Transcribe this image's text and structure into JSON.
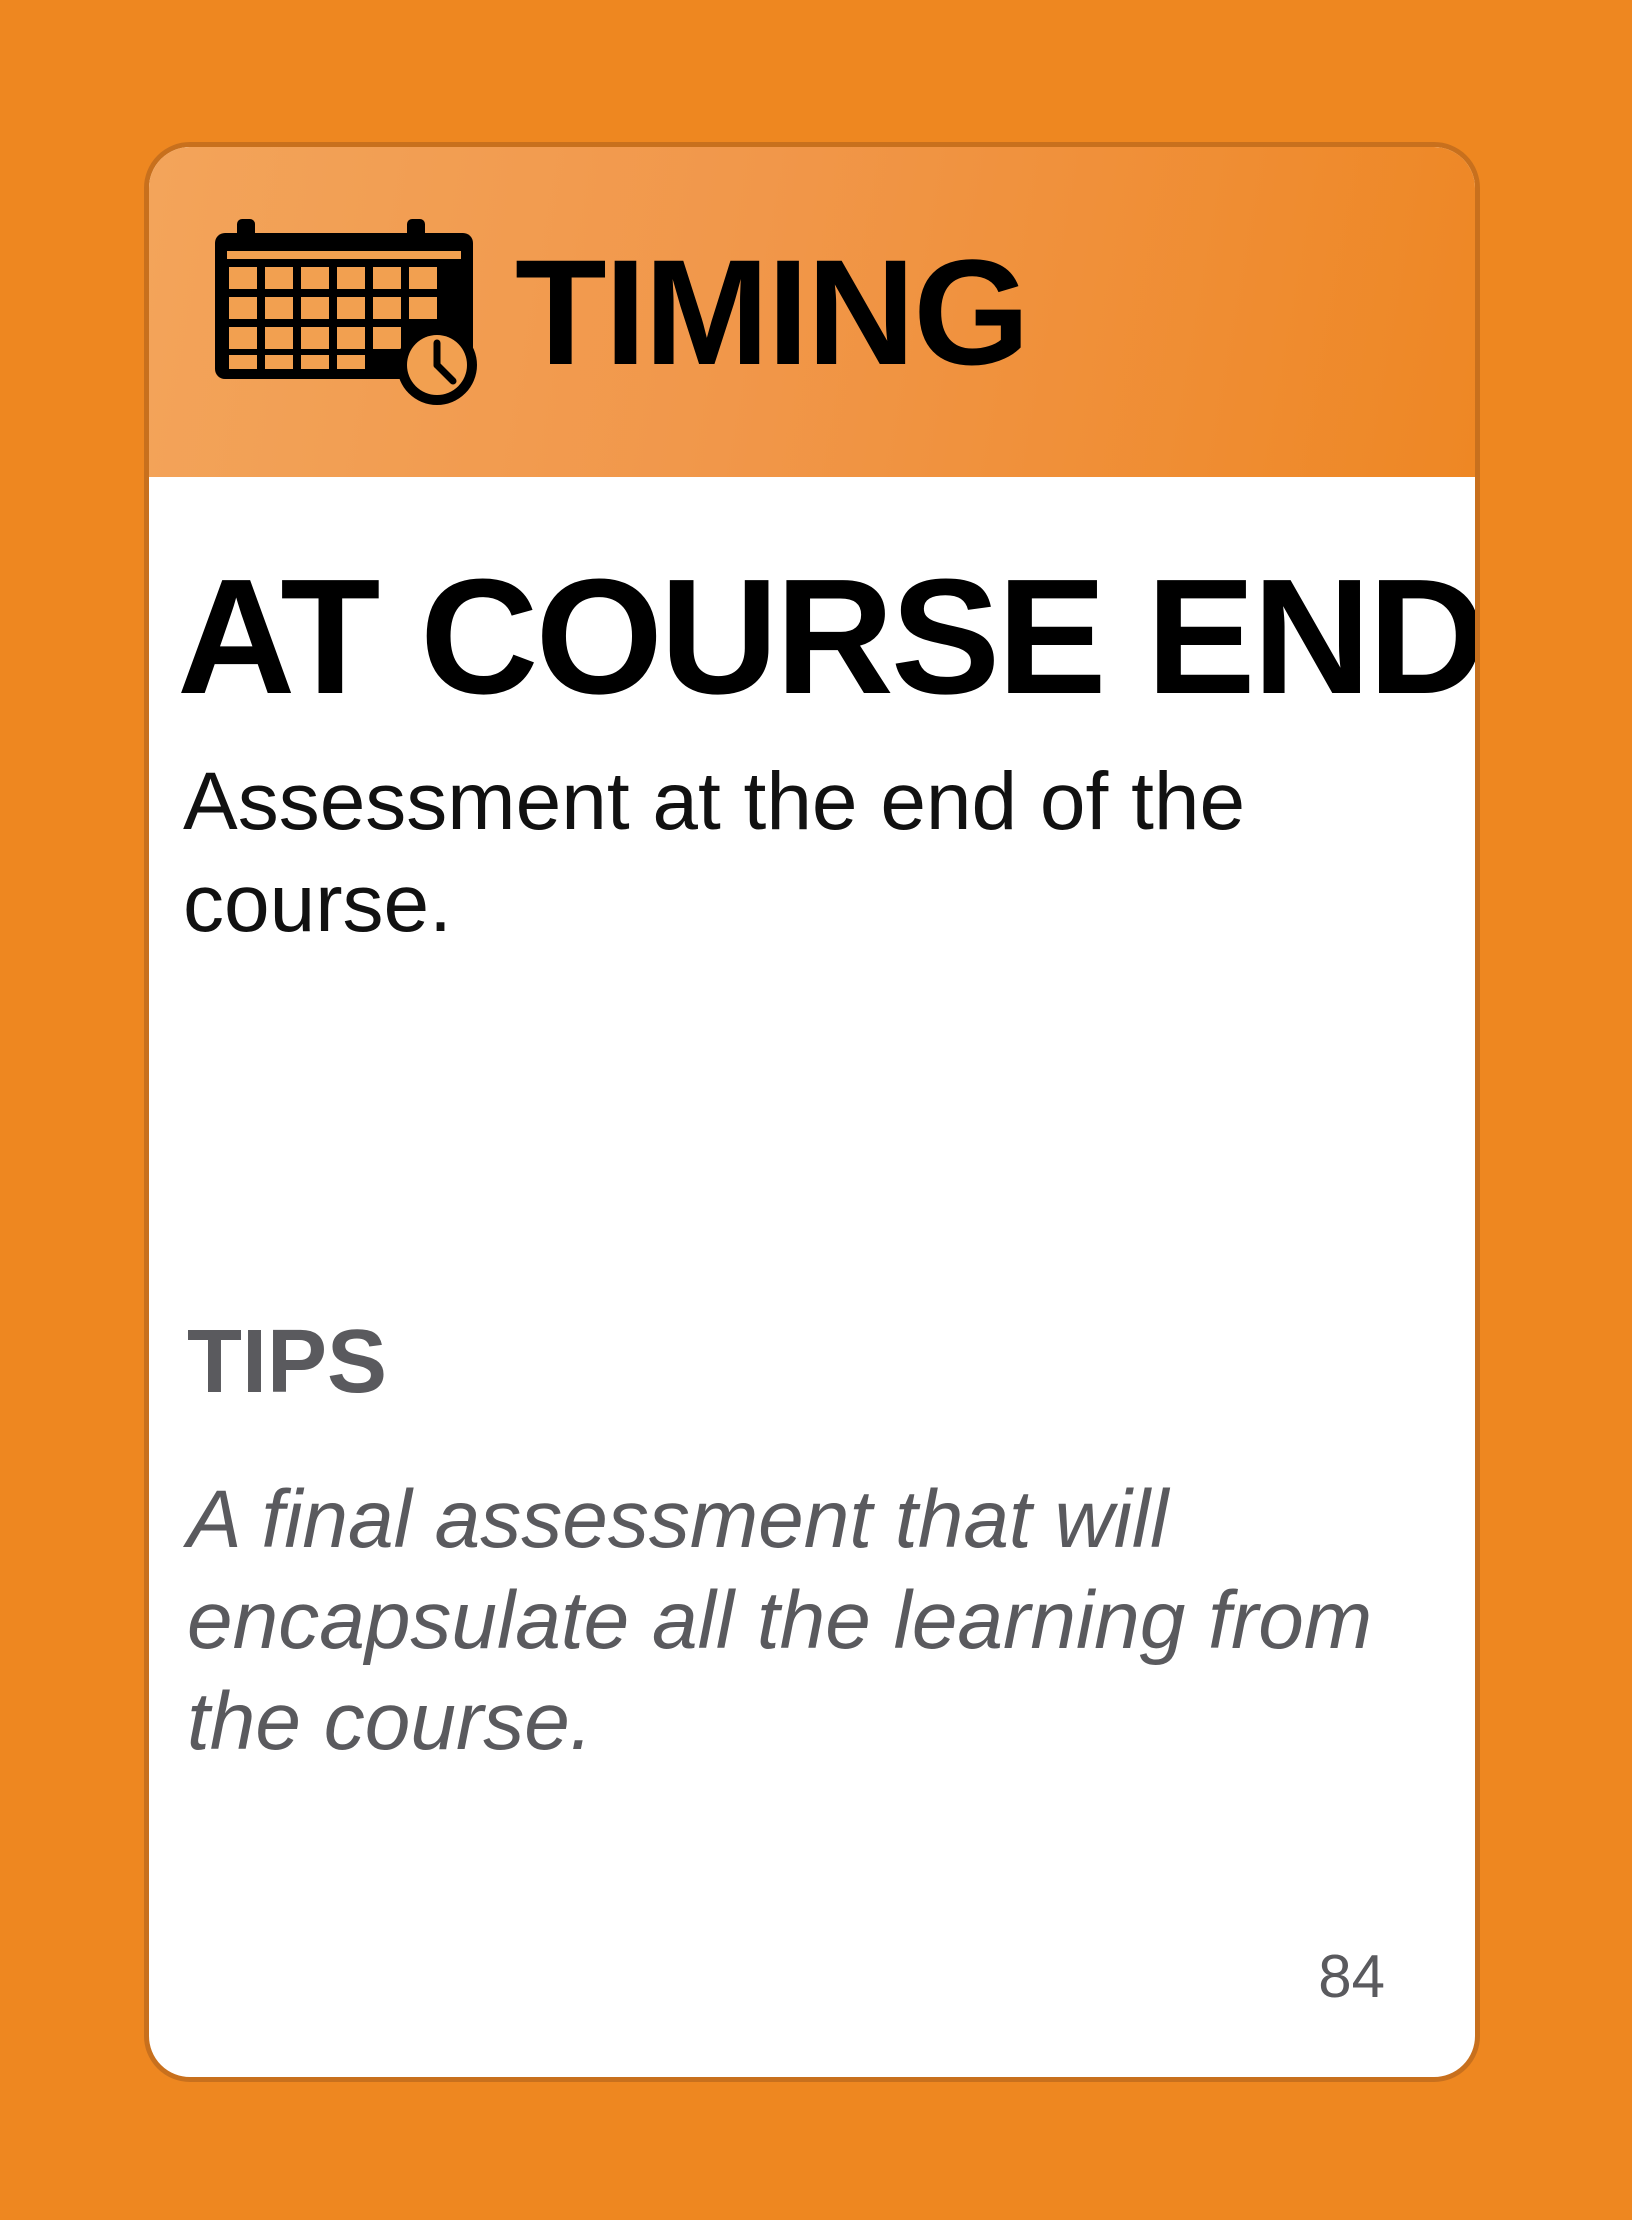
{
  "header": {
    "icon": "calendar-clock-icon",
    "category": "TIMING",
    "color": "#ee8720"
  },
  "card": {
    "title": "AT COURSE END",
    "description": "Assessment at the end of the course."
  },
  "tips": {
    "heading": "TIPS",
    "text": "A final assessment that will encapsulate all the learning from the course."
  },
  "page_number": "84"
}
